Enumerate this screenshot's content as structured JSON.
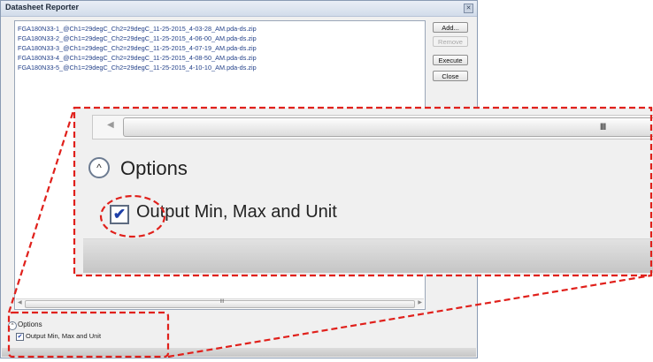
{
  "window": {
    "title": "Datasheet Reporter",
    "close_glyph": "✕"
  },
  "files": [
    "FGA180N33-1_@Ch1=29degC_Ch2=29degC_11-25-2015_4-03-28_AM.pda-ds.zip",
    "FGA180N33-2_@Ch1=29degC_Ch2=29degC_11-25-2015_4-06-00_AM.pda-ds.zip",
    "FGA180N33-3_@Ch1=29degC_Ch2=29degC_11-25-2015_4-07-19_AM.pda-ds.zip",
    "FGA180N33-4_@Ch1=29degC_Ch2=29degC_11-25-2015_4-08-50_AM.pda-ds.zip",
    "FGA180N33-5_@Ch1=29degC_Ch2=29degC_11-25-2015_4-10-10_AM.pda-ds.zip"
  ],
  "buttons": {
    "add": "Add...",
    "remove": "Remove",
    "execute": "Execute",
    "close": "Close"
  },
  "options": {
    "label": "Options",
    "checkbox_label": "Output Min, Max and Unit",
    "checked": true,
    "check_glyph": "✔",
    "chevron_glyph": "^"
  },
  "scrollbar": {
    "grip": "III",
    "left_arrow": "◀",
    "right_arrow": "▶"
  },
  "annotation": {
    "color": "#e0201b"
  }
}
